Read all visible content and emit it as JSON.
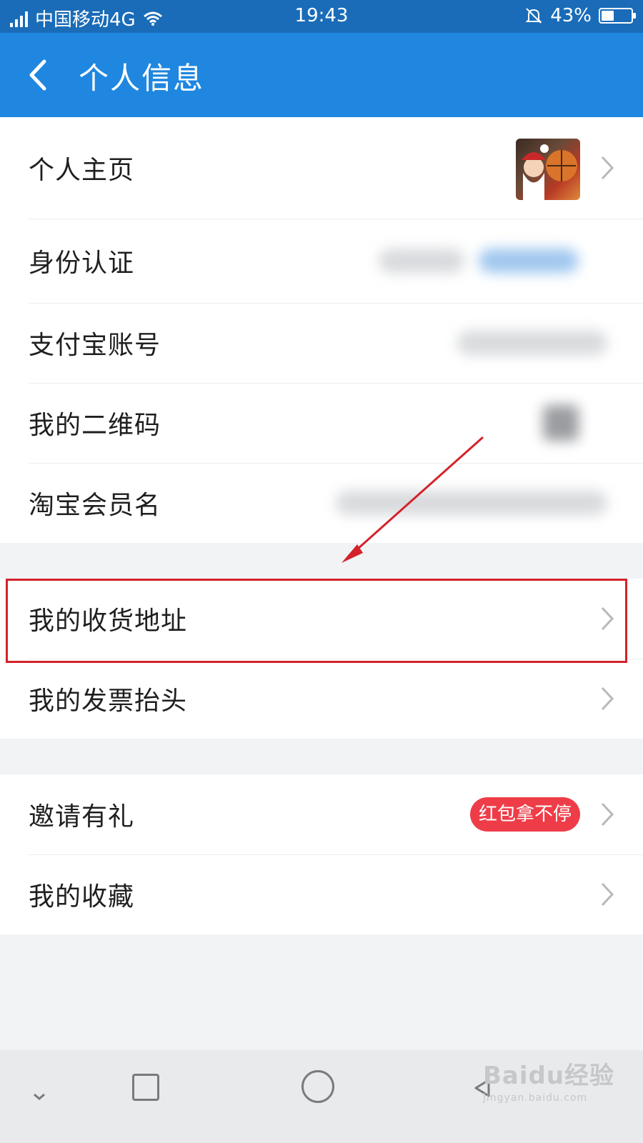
{
  "status_bar": {
    "carrier": "中国移动4G",
    "time": "19:43",
    "battery_percent": "43%",
    "battery_level": 0.43,
    "icons": [
      "signal-icon",
      "wifi-icon",
      "bell-off-icon",
      "battery-icon"
    ]
  },
  "header": {
    "title": "个人信息",
    "background": "#1f87e0",
    "icons": [
      "back-arrow-icon"
    ]
  },
  "profile_group": [
    {
      "label": "个人主页"
    },
    {
      "label": "身份认证"
    },
    {
      "label": "支付宝账号"
    },
    {
      "label": "我的二维码"
    },
    {
      "label": "淘宝会员名"
    }
  ],
  "address_group": [
    {
      "label": "我的收货地址"
    },
    {
      "label": "我的发票抬头"
    }
  ],
  "misc_group": [
    {
      "label": "邀请有礼",
      "badge": "红包拿不停"
    },
    {
      "label": "我的收藏"
    }
  ],
  "annotation": {
    "highlight_color": "#d4222a",
    "target": "我的收货地址"
  },
  "colors": {
    "accent": "#1f87e0",
    "badge": "#ee3d48",
    "background": "#f2f3f5"
  },
  "watermark": {
    "main": "Baidu经验",
    "sub": "jingyan.baidu.com"
  }
}
